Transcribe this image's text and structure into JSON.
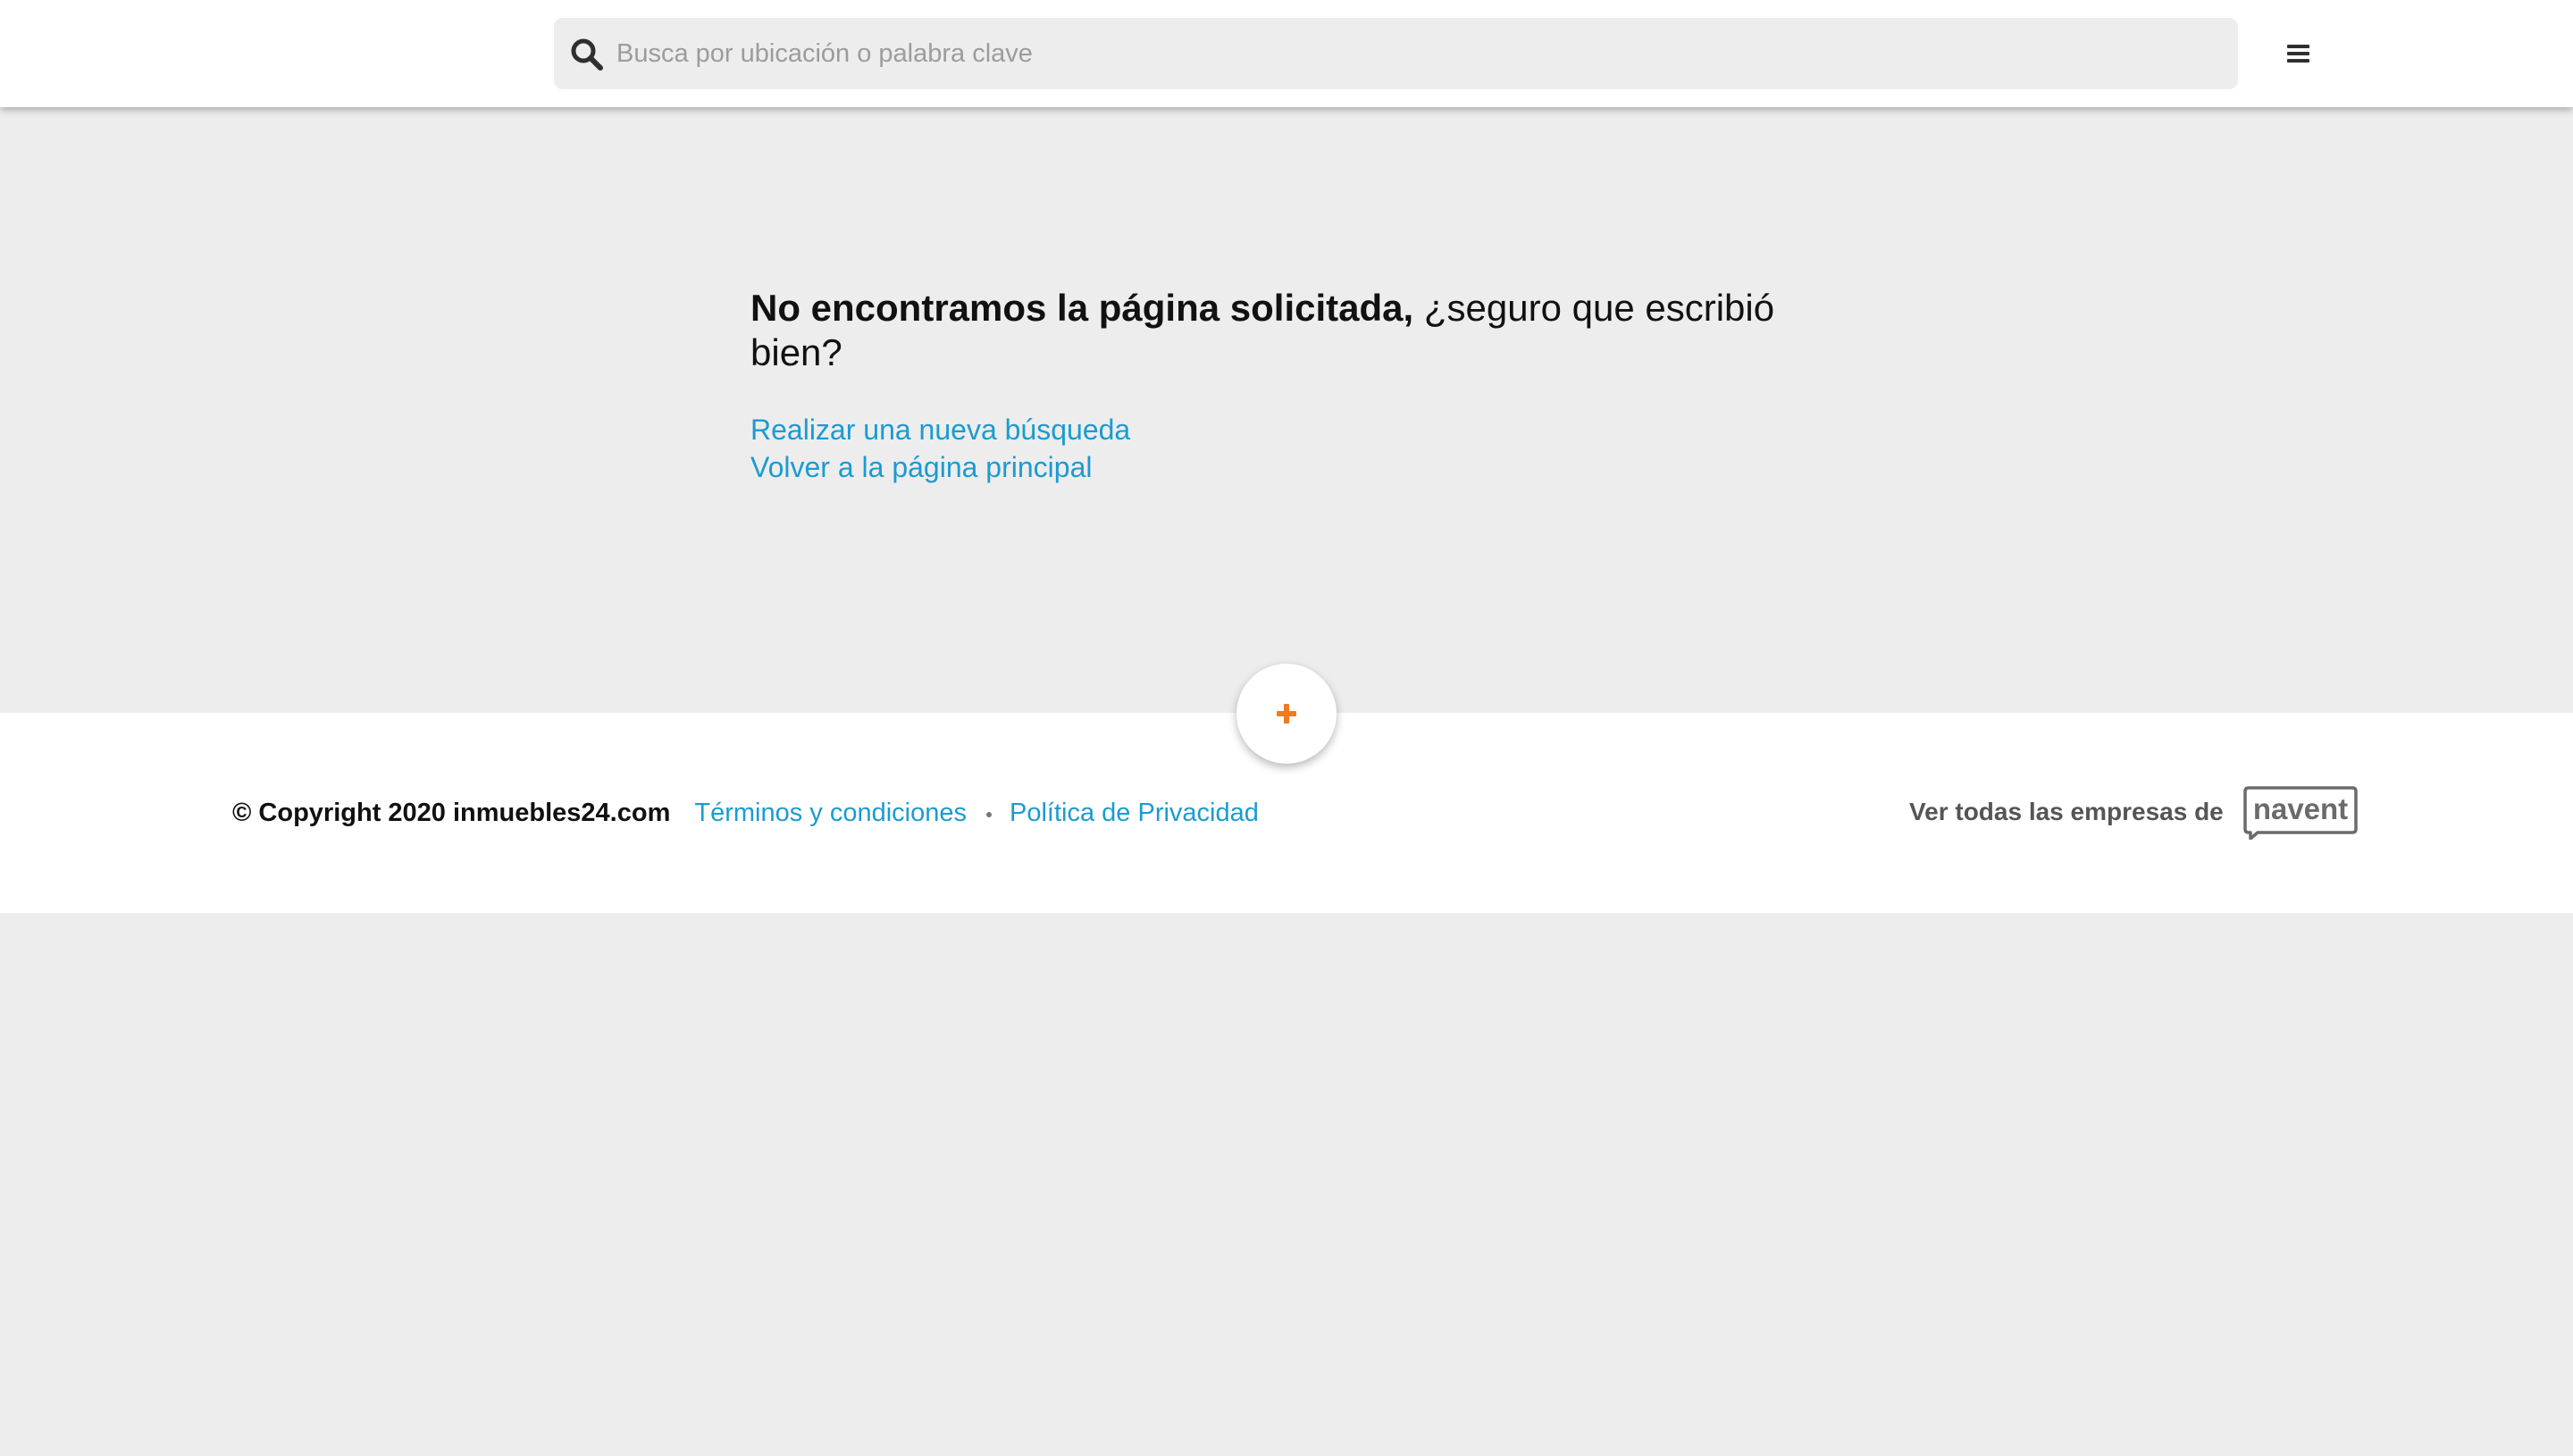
{
  "header": {
    "search": {
      "placeholder": "Busca por ubicación o palabra clave",
      "icon": "search-icon"
    },
    "menu_icon": "hamburger-menu-icon"
  },
  "main": {
    "headline_bold": "No encontramos la página solicitada,",
    "headline_rest": " ¿seguro que escribió bien?",
    "links": [
      {
        "label": "Realizar una nueva búsqueda"
      },
      {
        "label": "Volver a la página principal"
      }
    ]
  },
  "fab": {
    "icon": "plus-icon",
    "color": "#f07b22"
  },
  "footer": {
    "copyright": "© Copyright 2020 inmuebles24.com",
    "terms_label": "Términos y condiciones",
    "privacy_label": "Política de Privacidad",
    "companies_label": "Ver todas las empresas de",
    "logo_text": "navent"
  },
  "colors": {
    "link": "#1b9bd1",
    "background": "#ededed",
    "accent": "#f07b22"
  }
}
